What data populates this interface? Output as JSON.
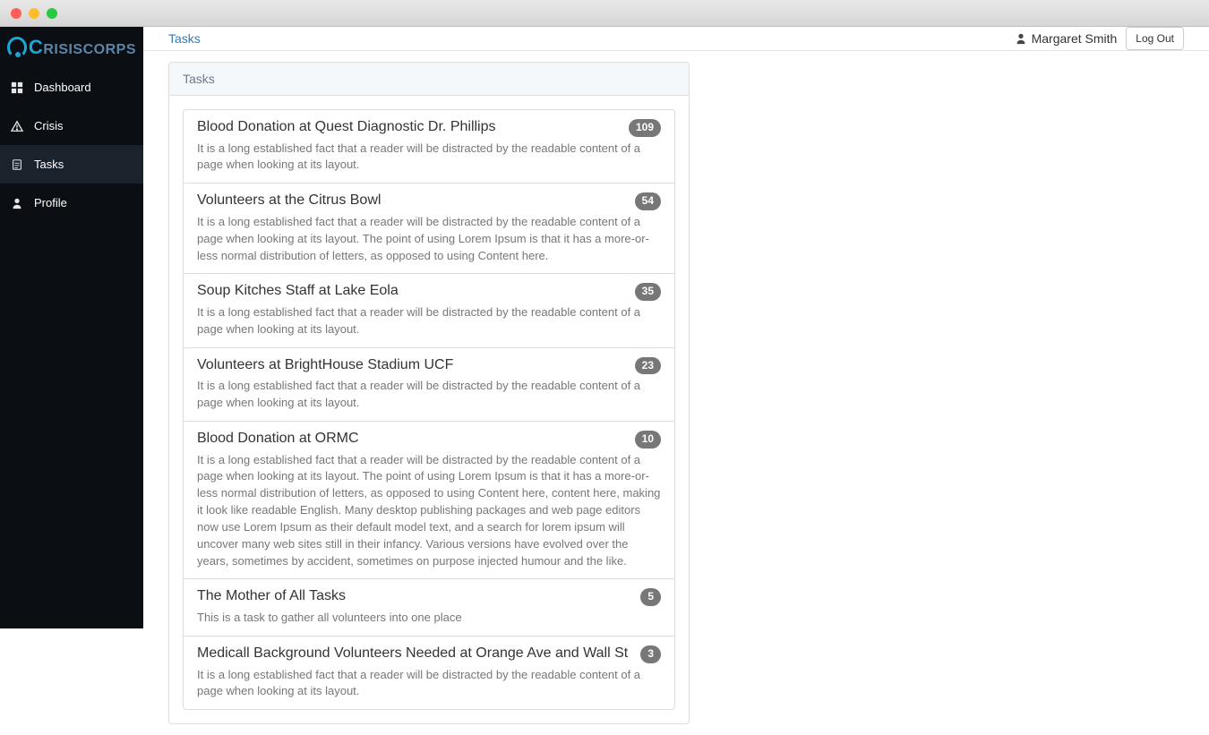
{
  "app_name_c": "C",
  "app_name_rest": "RISISCORPS",
  "sidebar": {
    "items": [
      {
        "label": "Dashboard",
        "icon": "dashboard-icon",
        "active": false
      },
      {
        "label": "Crisis",
        "icon": "alert-icon",
        "active": false
      },
      {
        "label": "Tasks",
        "icon": "clipboard-icon",
        "active": true
      },
      {
        "label": "Profile",
        "icon": "user-icon",
        "active": false
      }
    ]
  },
  "header": {
    "breadcrumb": "Tasks",
    "user_name": "Margaret Smith",
    "logout_label": "Log Out"
  },
  "panel": {
    "title": "Tasks"
  },
  "tasks": [
    {
      "title": "Blood Donation at Quest Diagnostic Dr. Phillips",
      "badge": "109",
      "desc": "It is a long established fact that a reader will be distracted by the readable content of a page when looking at its layout."
    },
    {
      "title": "Volunteers at the Citrus Bowl",
      "badge": "54",
      "desc": "It is a long established fact that a reader will be distracted by the readable content of a page when looking at its layout. The point of using Lorem Ipsum is that it has a more-or-less normal distribution of letters, as opposed to using Content here."
    },
    {
      "title": "Soup Kitches Staff at Lake Eola",
      "badge": "35",
      "desc": "It is a long established fact that a reader will be distracted by the readable content of a page when looking at its layout."
    },
    {
      "title": "Volunteers at BrightHouse Stadium UCF",
      "badge": "23",
      "desc": "It is a long established fact that a reader will be distracted by the readable content of a page when looking at its layout."
    },
    {
      "title": "Blood Donation at ORMC",
      "badge": "10",
      "desc": "It is a long established fact that a reader will be distracted by the readable content of a page when looking at its layout. The point of using Lorem Ipsum is that it has a more-or-less normal distribution of letters, as opposed to using Content here, content here, making it look like readable English. Many desktop publishing packages and web page editors now use Lorem Ipsum as their default model text, and a search for lorem ipsum will uncover many web sites still in their infancy. Various versions have evolved over the years, sometimes by accident, sometimes on purpose injected humour and the like."
    },
    {
      "title": "The Mother of All Tasks",
      "badge": "5",
      "desc": "This is a task to gather all volunteers into one place"
    },
    {
      "title": "Medicall Background Volunteers Needed at Orange Ave and Wall St",
      "badge": "3",
      "desc": "It is a long established fact that a reader will be distracted by the readable content of a page when looking at its layout."
    }
  ]
}
